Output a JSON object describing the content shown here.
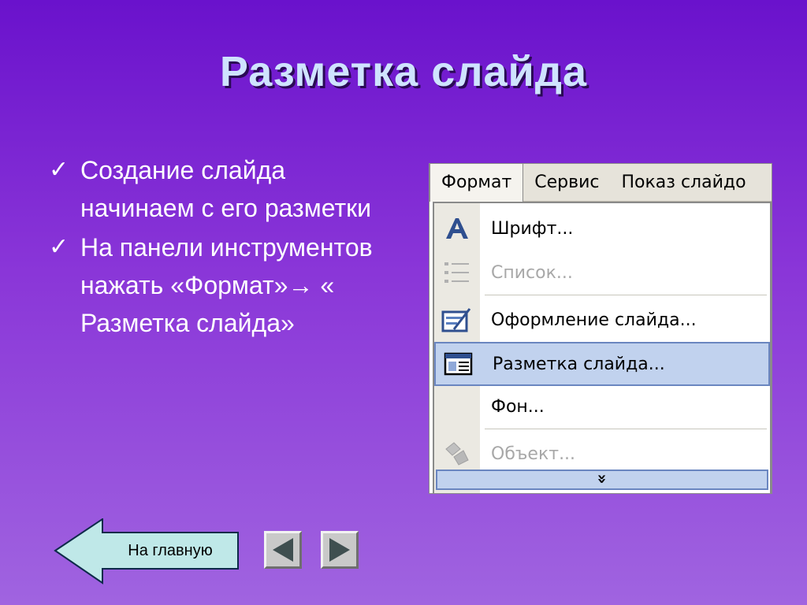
{
  "title": "Разметка слайда",
  "bullets": [
    {
      "icon": "checkmark-icon",
      "text": "Создание слайда начинаем с его разметки"
    },
    {
      "icon": "checkmark-icon",
      "text": "На панели инструментов нажать «Формат»→ « Разметка слайда»"
    }
  ],
  "menubar": {
    "items": [
      "Формат",
      "Сервис",
      "Показ слайдо"
    ]
  },
  "dropdown": {
    "items": [
      {
        "label": "Шрифт...",
        "icon": "font-icon",
        "disabled": false
      },
      {
        "label": "Список...",
        "icon": "list-icon",
        "disabled": true
      },
      {
        "label": "Оформление слайда...",
        "icon": "slide-design-icon",
        "disabled": false
      },
      {
        "label": "Разметка слайда...",
        "icon": "slide-layout-icon",
        "disabled": false,
        "selected": true
      },
      {
        "label": "Фон...",
        "icon": "",
        "disabled": false
      },
      {
        "label": "Объект...",
        "icon": "object-icon",
        "disabled": true
      }
    ],
    "expand_glyph": "»"
  },
  "nav": {
    "home_label": "На главную",
    "prev_icon": "triangle-left-icon",
    "next_icon": "triangle-right-icon"
  },
  "colors": {
    "background_top": "#6a12cc",
    "background_bottom": "#a064e0",
    "title": "#cfe3ff",
    "selection": "#c1d2ee"
  }
}
